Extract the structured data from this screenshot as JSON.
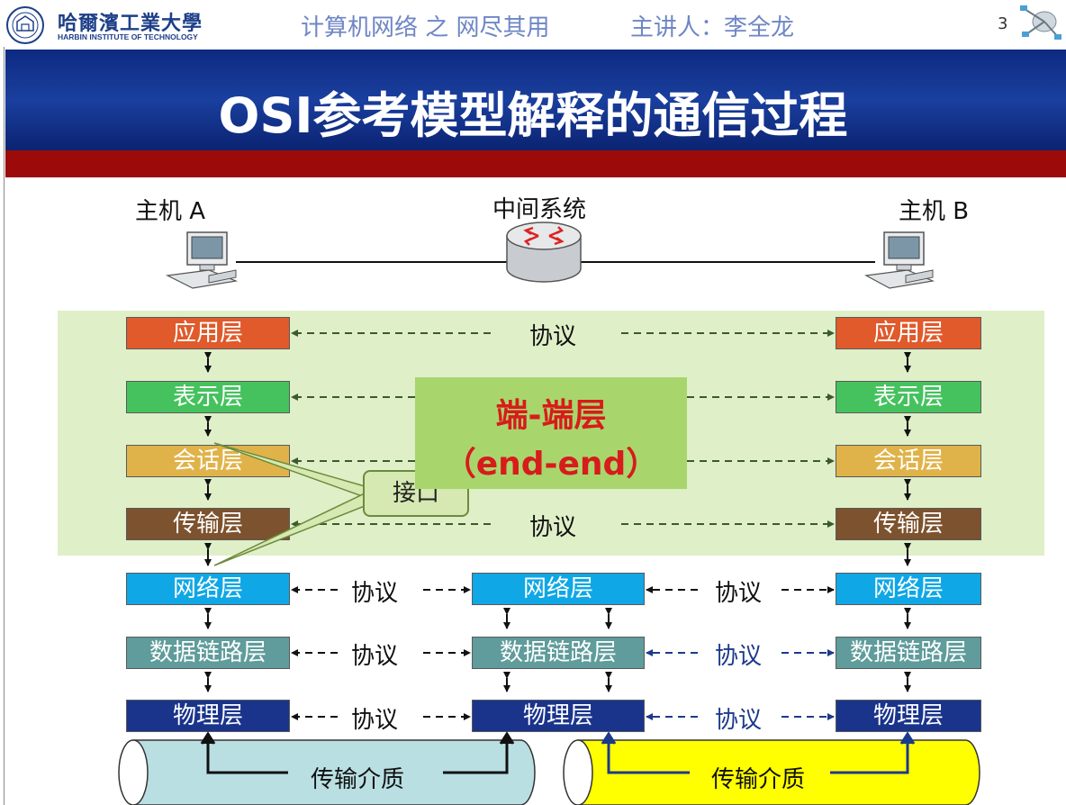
{
  "header": {
    "logo_cn": "哈爾濱工業大學",
    "logo_en": "HARBIN INSTITUTE OF TECHNOLOGY",
    "course": "计算机网络 之 网尽其用",
    "lecturer": "主讲人：李全龙",
    "page_number": "3"
  },
  "slide": {
    "title": "OSI参考模型解释的通信过程"
  },
  "hosts": {
    "host_a": "主机 A",
    "middle": "中间系统",
    "host_b": "主机 B"
  },
  "layers": {
    "application": "应用层",
    "presentation": "表示层",
    "session": "会话层",
    "transport": "传输层",
    "network": "网络层",
    "data_link": "数据链路层",
    "physical": "物理层"
  },
  "protocol_label": "协议",
  "end_to_end": {
    "line1": "端-端层",
    "line2": "（end-end）"
  },
  "interface_label": "接口",
  "medium_label": "传输介质",
  "colors": {
    "title_band": "#1a3f9e",
    "red_band": "#9c0a0a",
    "end_to_end_zone": "#dfefc8",
    "end_to_end_box": "#a8d66d",
    "end_to_end_text": "#d81b1b",
    "medium_left": "#b9dfe3",
    "medium_right": "#ffff00"
  }
}
